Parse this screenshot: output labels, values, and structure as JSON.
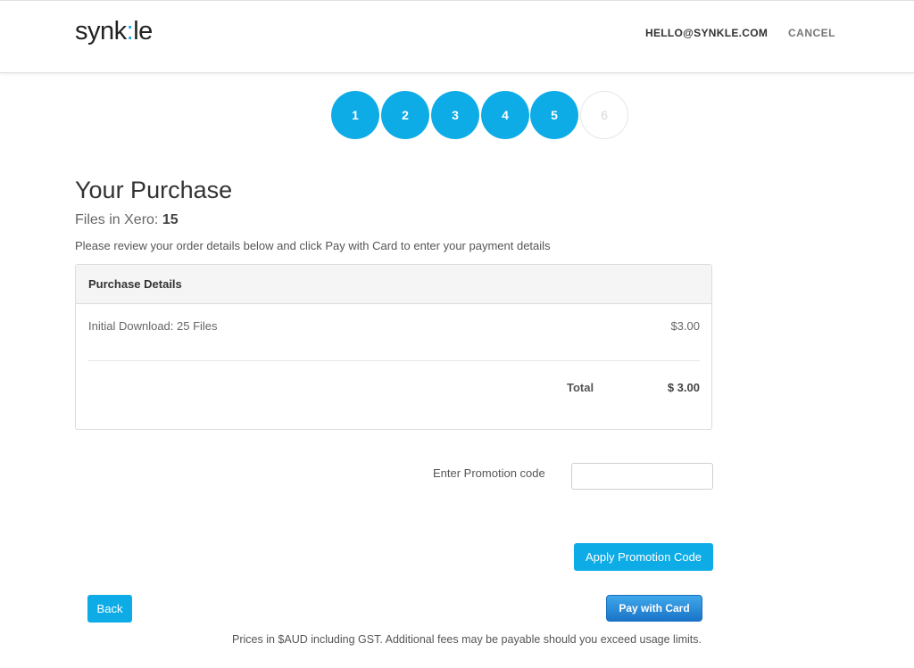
{
  "header": {
    "logo_parts": [
      "synk",
      ":",
      "le"
    ],
    "email": "HELLO@SYNKLE.COM",
    "cancel": "CANCEL"
  },
  "steps": [
    {
      "label": "1",
      "state": "done"
    },
    {
      "label": "2",
      "state": "done"
    },
    {
      "label": "3",
      "state": "done"
    },
    {
      "label": "4",
      "state": "done"
    },
    {
      "label": "5",
      "state": "current"
    },
    {
      "label": "6",
      "state": "pending"
    }
  ],
  "main": {
    "title": "Your Purchase",
    "files_label": "Files in Xero:",
    "files_count": "15",
    "intro": "Please review your order details below and click Pay with Card to enter your payment details"
  },
  "panel": {
    "heading": "Purchase Details",
    "item_name": "Initial Download: 25 Files",
    "item_price": "$3.00",
    "total_label": "Total",
    "total_value": "$ 3.00"
  },
  "promo": {
    "label": "Enter Promotion code",
    "value": "",
    "placeholder": "",
    "apply_button": "Apply Promotion Code"
  },
  "actions": {
    "back": "Back",
    "pay": "Pay with Card"
  },
  "footer": {
    "note": "Prices in $AUD including GST. Additional fees may be payable should you exceed usage limits."
  },
  "colors": {
    "accent": "#0eace7",
    "pay_button": "#1a74c8",
    "inactive_step": "#d7d7d7"
  }
}
